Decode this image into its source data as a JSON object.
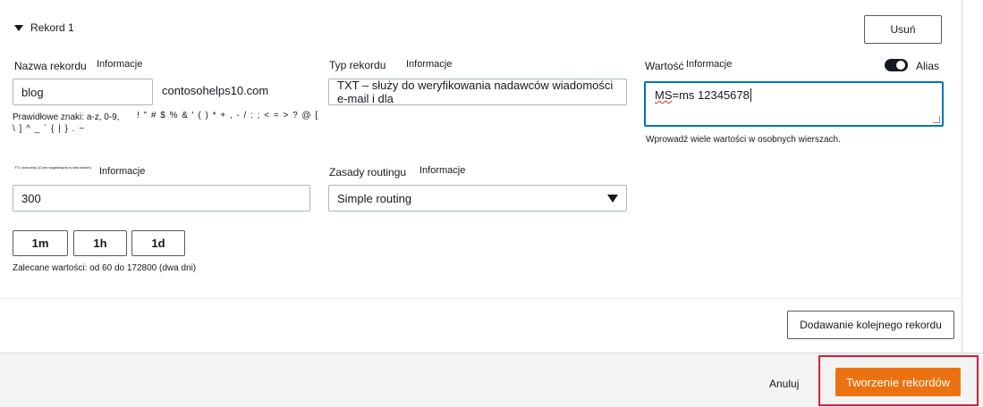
{
  "record": {
    "title": "Rekord 1",
    "delete_label": "Usuń"
  },
  "record_name": {
    "label": "Nazwa rekordu",
    "info": "Informacje",
    "value": "blog",
    "domain_suffix": "contosohelps10.com",
    "hint_line1_a": "Prawidłowe znaki: a-z, 0-9,",
    "hint_line1_b": "! \" # $ % & ' ( ) * + , - / : ; < = > ? @ [",
    "hint_line2": "\\ ] ^ _ ` { | } . ~"
  },
  "record_type": {
    "label": "Typ rekordu",
    "info": "Informacje",
    "value": "TXT – służy do weryfikowania nadawców wiadomości e-mail i dla"
  },
  "value_field": {
    "label": "Wartość",
    "info": "Informacje",
    "alias_label": "Alias",
    "alias_on": false,
    "text_prefix": "MS",
    "text_rest": "=ms 12345678",
    "hint": "Wprowadź wiele wartości w osobnych wierszach."
  },
  "ttl": {
    "label": "TTL (sekundy) (Czas wygaśnięcia w sekundach)",
    "info": "Informacje",
    "value": "300",
    "quick_buttons": [
      "1m",
      "1h",
      "1d"
    ],
    "recommended": "Zalecane wartości: od 60 do 172800 (dwa dni)"
  },
  "routing": {
    "label": "Zasady routingu",
    "info": "Informacje",
    "value": "Simple routing"
  },
  "add_record_label": "Dodawanie kolejnego rekordu",
  "footer": {
    "cancel_label": "Anuluj",
    "create_label": "Tworzenie rekordów"
  },
  "colors": {
    "primary": "#ec7211",
    "focus": "#0073bb",
    "highlight": "#d91d3a"
  }
}
